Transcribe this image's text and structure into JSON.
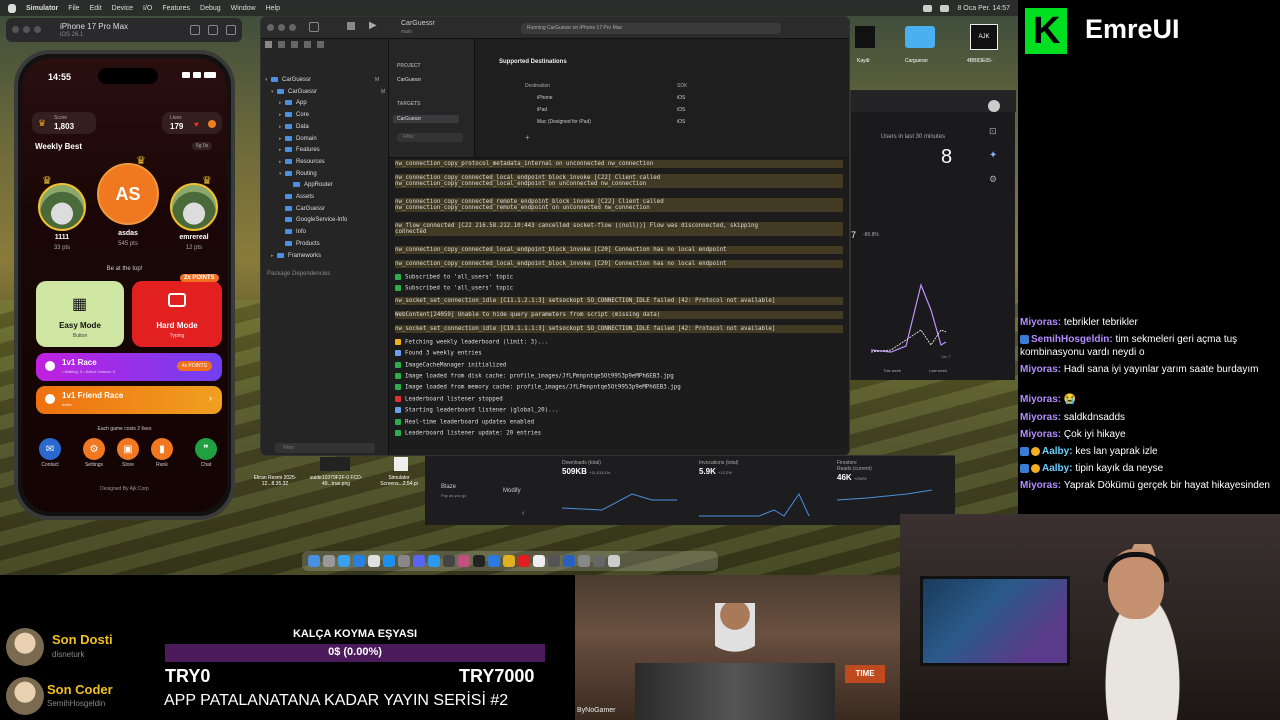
{
  "menubar": {
    "items": [
      "Simulator",
      "File",
      "Edit",
      "Device",
      "I/O",
      "Features",
      "Debug",
      "Window",
      "Help"
    ],
    "clock": "8 Oca Per. 14:57"
  },
  "simulator": {
    "device": "iPhone 17 Pro Max",
    "os": "iOS 26.1"
  },
  "phone": {
    "time": "14:55",
    "score_label": "Score",
    "score": "1,803",
    "lives_label": "Lives",
    "lives": "179",
    "weekly_best": "Weekly Best",
    "weekly_timer": "6g 0s",
    "podium": [
      {
        "name": "1111",
        "points": "33 pts"
      },
      {
        "initials": "AS",
        "name": "asdas",
        "points": "545 pts"
      },
      {
        "name": "emrereal",
        "points": "12 pts"
      }
    ],
    "be_at_top": "Be at the top!",
    "easy": {
      "title": "Easy Mode",
      "subtitle": "Button"
    },
    "hard": {
      "title": "Hard Mode",
      "subtitle": "Typing",
      "badge": "2x POINTS"
    },
    "race": {
      "title": "1v1 Race",
      "subtitle": "• Waiting: 0 • Active Games: 0",
      "badge": "4x POINTS"
    },
    "friend_race": {
      "title": "1v1 Friend Race",
      "subtitle": "Invite"
    },
    "costs": "Each game costs 2 lives",
    "nav": [
      "Contact",
      "Settings",
      "Store",
      "Rank",
      "Chat"
    ],
    "designed": "Designed By Ajk Corp"
  },
  "xcode": {
    "project": "CarGuessr",
    "branch": "main",
    "run_status": "Running CarGuessr on iPhone 17 Pro Max",
    "tree": [
      "CarGuessr",
      "CarGuessr",
      "App",
      "Core",
      "Data",
      "Domain",
      "Features",
      "Resources",
      "Routing",
      "AppRouter",
      "Assets",
      "CarGuessr",
      "GoogleService-Info",
      "Info",
      "Products",
      "Frameworks"
    ],
    "tree_marks": [
      "M",
      "M",
      "",
      "",
      "",
      "",
      "",
      "",
      "",
      "",
      "M",
      "M",
      "M",
      "M",
      "",
      ""
    ],
    "package_deps": "Package Dependencies",
    "project_label": "PROJECT",
    "targets_label": "TARGETS",
    "target": "CarGuessr",
    "supported": "Supported Destinations",
    "dest_header": [
      "Destination",
      "SDK"
    ],
    "destinations": [
      [
        "iPhone",
        "iOS"
      ],
      [
        "iPad",
        "iOS"
      ],
      [
        "Mac (Designed for iPad)",
        "iOS"
      ]
    ],
    "filter": "Filter",
    "console": [
      {
        "t": "nw_connection_copy_protocol_metadata_internal on unconnected nw_connection",
        "k": "warn"
      },
      {
        "t": "nw_connection_copy_connected_local_endpoint_block_invoke [C22] Client called\nnw_connection_copy_connected_local_endpoint on unconnected nw_connection",
        "k": "warn"
      },
      {
        "t": "nw_connection_copy_connected_remote_endpoint_block_invoke [C22] Client called\nnw_connection_copy_connected_remote_endpoint on unconnected nw_connection",
        "k": "warn"
      },
      {
        "t": "nw_flow_connected [C22 216.58.212.10:443 cancelled socket-flow ((null))] Flow was disconnected, skipping\nconnected",
        "k": "warn"
      },
      {
        "t": "nw_connection_copy_connected_local_endpoint_block_invoke [C20] Connection has no local endpoint",
        "k": "warn"
      },
      {
        "t": "nw_connection_copy_connected_local_endpoint_block_invoke [C20] Connection has no local endpoint",
        "k": "warn"
      },
      {
        "t": "Subscribed to 'all_users' topic",
        "k": "ok"
      },
      {
        "t": "Subscribed to 'all_users' topic",
        "k": "ok"
      },
      {
        "t": "nw_socket_set_connection_idle [C11.1.2.1:3] setsockopt SO_CONNECTION_IDLE failed [42: Protocol not available]",
        "k": "warn"
      },
      {
        "t": "WebContent[24059] Unable to hide query parameters from script (missing data)",
        "k": "warn"
      },
      {
        "t": "nw_socket_set_connection_idle [C19.1.1.1:3] setsockopt SO_CONNECTION_IDLE failed [42: Protocol not available]",
        "k": "warn"
      },
      {
        "t": "Fetching weekly leaderboard (limit: 3)...",
        "k": "trophy"
      },
      {
        "t": "Found 3 weekly entries",
        "k": "info"
      },
      {
        "t": "ImageCacheManager initialized",
        "k": "ok"
      },
      {
        "t": "Image loaded from disk cache: profile_images/JfLPmnpntqe5Ot9953p9eMPh6EB3.jpg",
        "k": "ok"
      },
      {
        "t": "Image loaded from memory cache: profile_images/JfLPmnpntqe5Ot9953p9eMPh6EB3.jpg",
        "k": "ok"
      },
      {
        "t": "Leaderboard listener stopped",
        "k": "stop"
      },
      {
        "t": "Starting leaderboard listener (global_20)...",
        "k": "info"
      },
      {
        "t": "Real-time leaderboard updates enabled",
        "k": "ok"
      },
      {
        "t": "Leaderboard listener update: 20 entries",
        "k": "ok"
      }
    ]
  },
  "analytics": {
    "users_label": "Users in last 30 minutes",
    "users": "8",
    "chart_value": "7",
    "chart_change": "-86.8%",
    "legend": [
      "This week",
      "Last week"
    ],
    "x_label": "Jan 7"
  },
  "firebase": {
    "plan": "Blaze",
    "plan_sub": "Pay as you go",
    "modify": "Modify",
    "stats": [
      {
        "label": "Downloads",
        "sub": "(total)",
        "value": "509KB",
        "change": "+11,013.1%"
      },
      {
        "label": "Invocations",
        "sub": "(total)",
        "value": "5.9K",
        "change": "+12.2%"
      },
      {
        "label": "Reads",
        "sub": "(current)",
        "value": "46K",
        "change": "+250%"
      }
    ],
    "firestore": "Firestore"
  },
  "desktop_files": [
    "Ekran Resmi 2025-12...8.35.32",
    "uuide10379F2F-0 FCD-49...true.png",
    "Simulator Screens...2.54.pi"
  ],
  "desktop_icons": [
    "Kaydi",
    "Carguessr",
    "4BB83E65-"
  ],
  "brand": "EmreUI",
  "chat": [
    {
      "user": "Miyoras",
      "text": "tebrikler tebrikler",
      "badge": ""
    },
    {
      "user": "SemihHosgeldin",
      "text": "tim sekmeleri geri açma tuş kombinasyonu vardı neydi o",
      "badge": "mod"
    },
    {
      "user": "Miyoras",
      "text": "Hadi sana iyi yayınlar yarım saate burdayım",
      "badge": ""
    },
    {
      "user": "Miyoras",
      "text": "😭",
      "badge": ""
    },
    {
      "user": "Miyoras",
      "text": "saldkdnsadds",
      "badge": ""
    },
    {
      "user": "Miyoras",
      "text": "Çok iyi hikaye",
      "badge": ""
    },
    {
      "user": "Aalby",
      "text": "kes lan yaprak izle",
      "badge": "mod2"
    },
    {
      "user": "Aalby",
      "text": "tipin kayık da neyse",
      "badge": "mod2"
    },
    {
      "user": "Miyoras",
      "text": "Yaprak Dökümü gerçek bir hayat hikayesinden",
      "badge": ""
    }
  ],
  "fans": [
    {
      "title": "Son Dosti",
      "name": "disneturk"
    },
    {
      "title": "Son Coder",
      "name": "SemihHosgeldin"
    }
  ],
  "goal": {
    "title": "KALÇA KOYMA EŞYASI",
    "progress_text": "0$ (0.00%)",
    "progress": 0,
    "min": "TRY0",
    "max": "TRY7000"
  },
  "series": "APP PATALANATANA KADAR YAYIN SERİSİ #2",
  "kiosk": {
    "sign": "TIME",
    "tag": "ByNoGamer"
  },
  "colors": {
    "accent_green": "#00e020",
    "phone_orange": "#f07820",
    "hard_red": "#e22020",
    "race_purple": "#c020e0",
    "chat_user": "#b58cff",
    "fan_gold": "#f0c020"
  }
}
